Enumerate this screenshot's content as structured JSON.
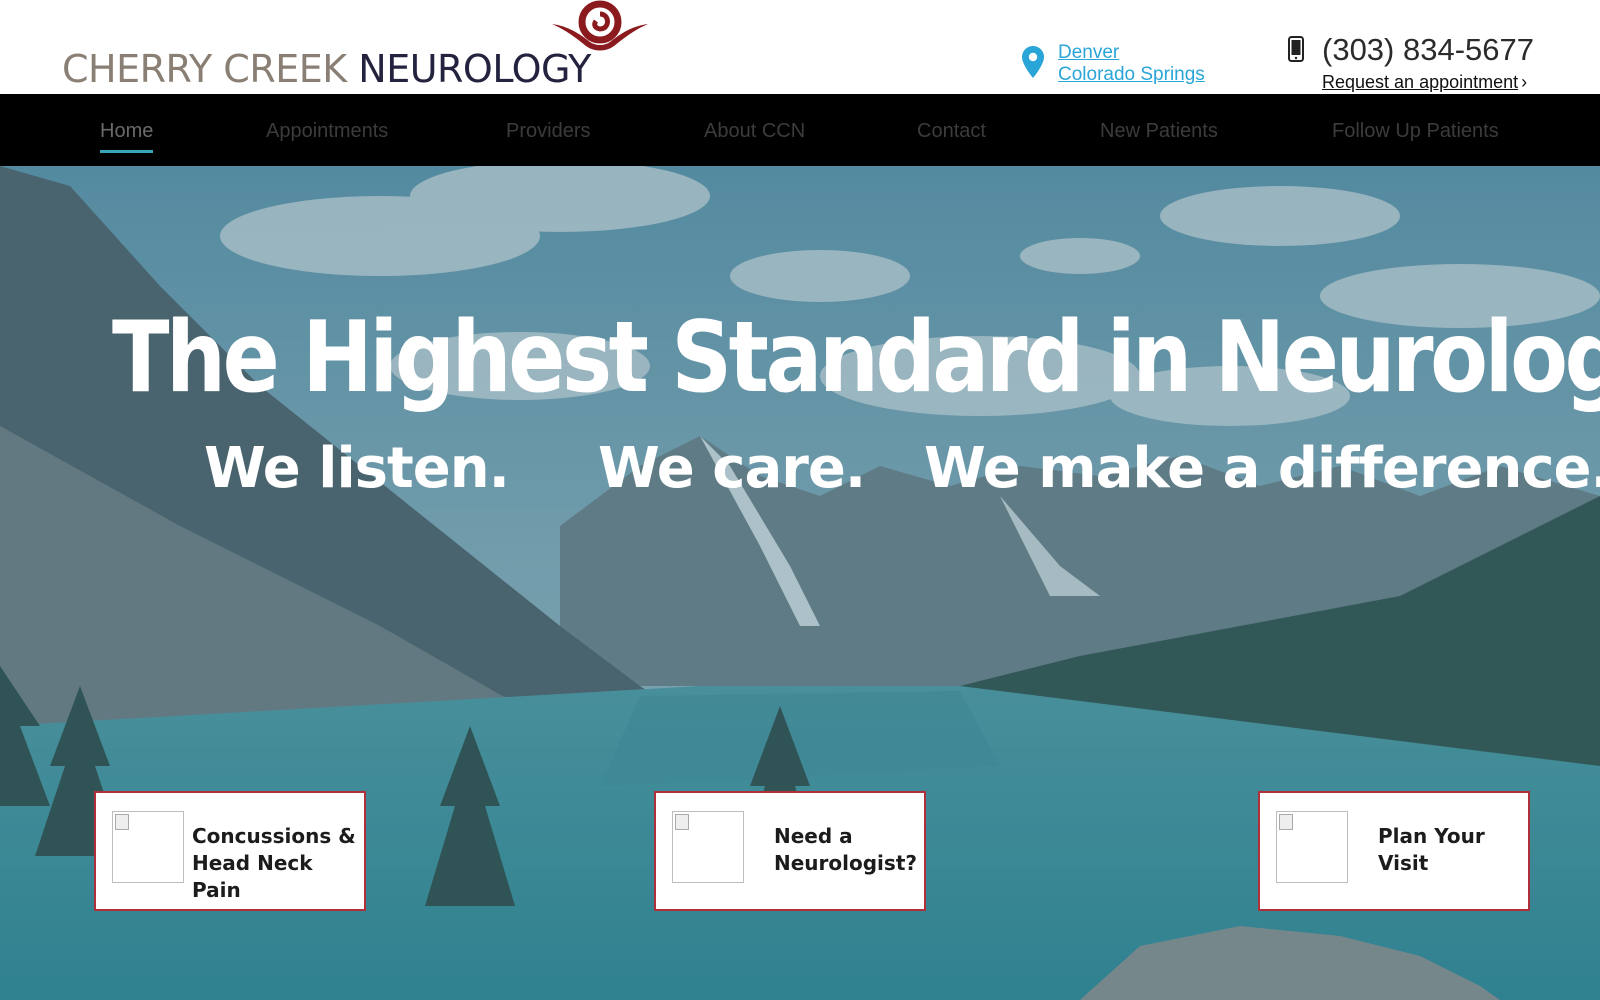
{
  "header": {
    "logo": {
      "word1": "CHERRY CREEK",
      "word2": "NEUROLOGY"
    },
    "locations": [
      "Denver",
      "Colorado Springs"
    ],
    "phone": "(303) 834-5677",
    "appointment_link": "Request an appointment",
    "icons": {
      "location": "map-pin-icon",
      "phone": "mobile-phone-icon",
      "chevron": "chevron-right-icon"
    }
  },
  "nav": {
    "items": [
      {
        "label": "Home",
        "active": true
      },
      {
        "label": "Appointments"
      },
      {
        "label": "Providers"
      },
      {
        "label": "About CCN"
      },
      {
        "label": "Contact"
      },
      {
        "label": "New Patients"
      },
      {
        "label": "Follow Up Patients"
      }
    ]
  },
  "hero": {
    "title": "The Highest Standard in Neurology",
    "taglines": [
      "We listen.",
      "We care.",
      "We make a difference."
    ],
    "cards": [
      {
        "label": "Concussions &\nHead Neck Pain"
      },
      {
        "label": "Need a\nNeurologist?"
      },
      {
        "label": "Plan Your\nVisit"
      }
    ]
  },
  "colors": {
    "accent_link": "#2aa5d8",
    "nav_bg": "#000000",
    "nav_active_underline": "#3aa4b8",
    "card_border": "#b0303a",
    "logo_mark": "#8b1a1f"
  }
}
